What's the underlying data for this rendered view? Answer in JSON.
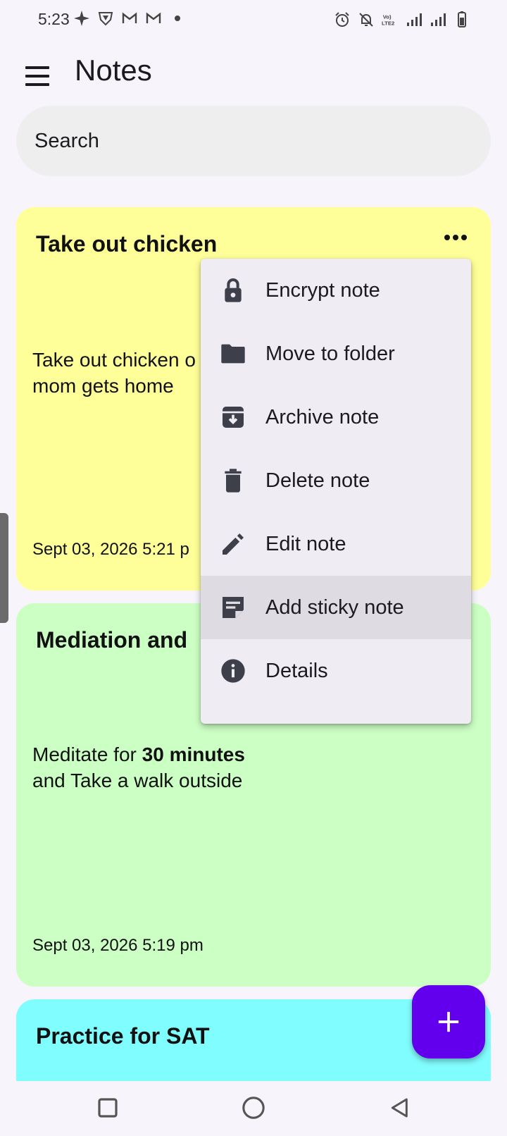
{
  "status_bar": {
    "time": "5:23",
    "left_icons": [
      "sparkle-icon",
      "shield-icon",
      "gmail-icon",
      "gmail-icon",
      "dot-icon"
    ],
    "right_icons": [
      "alarm-icon",
      "bell-off-icon",
      "volte-icon",
      "signal-icon",
      "signal-icon",
      "battery-icon"
    ],
    "volte_text": "Vo) LTE2"
  },
  "app_bar": {
    "title": "Notes",
    "menu_icon": "hamburger-menu-icon"
  },
  "search": {
    "placeholder": "Search",
    "value": ""
  },
  "notes": [
    {
      "title": "Take out chicken",
      "body_line1": "Take out chicken o",
      "body_line2": "mom gets home",
      "date": "Sept 03, 2026 5:21 p",
      "color": "#ffff99"
    },
    {
      "title": "Mediation and",
      "body_pre": "Meditate for ",
      "body_bold": "30 minutes",
      "body_line2": "and Take a walk outside",
      "date": "Sept 03, 2026 5:19 pm",
      "color": "#ccffc4"
    },
    {
      "title": "Practice for SAT",
      "color": "#80fdfe"
    }
  ],
  "context_menu": {
    "items": [
      {
        "label": "Encrypt note",
        "icon": "lock-icon"
      },
      {
        "label": "Move to folder",
        "icon": "folder-icon"
      },
      {
        "label": "Archive note",
        "icon": "archive-icon"
      },
      {
        "label": "Delete note",
        "icon": "trash-icon"
      },
      {
        "label": "Edit note",
        "icon": "pencil-icon"
      },
      {
        "label": "Add sticky note",
        "icon": "sticky-note-icon",
        "highlighted": true
      },
      {
        "label": "Details",
        "icon": "info-icon"
      }
    ]
  },
  "fab": {
    "icon": "plus-icon",
    "color": "#6200ee"
  },
  "nav_bar": {
    "buttons": [
      "recents-square-icon",
      "home-circle-icon",
      "back-triangle-icon"
    ]
  },
  "colors": {
    "background": "#f7f5fb",
    "menu_bg": "#efedf3",
    "menu_highlight": "#dedce2",
    "icon_dark": "#3d3f4a"
  }
}
